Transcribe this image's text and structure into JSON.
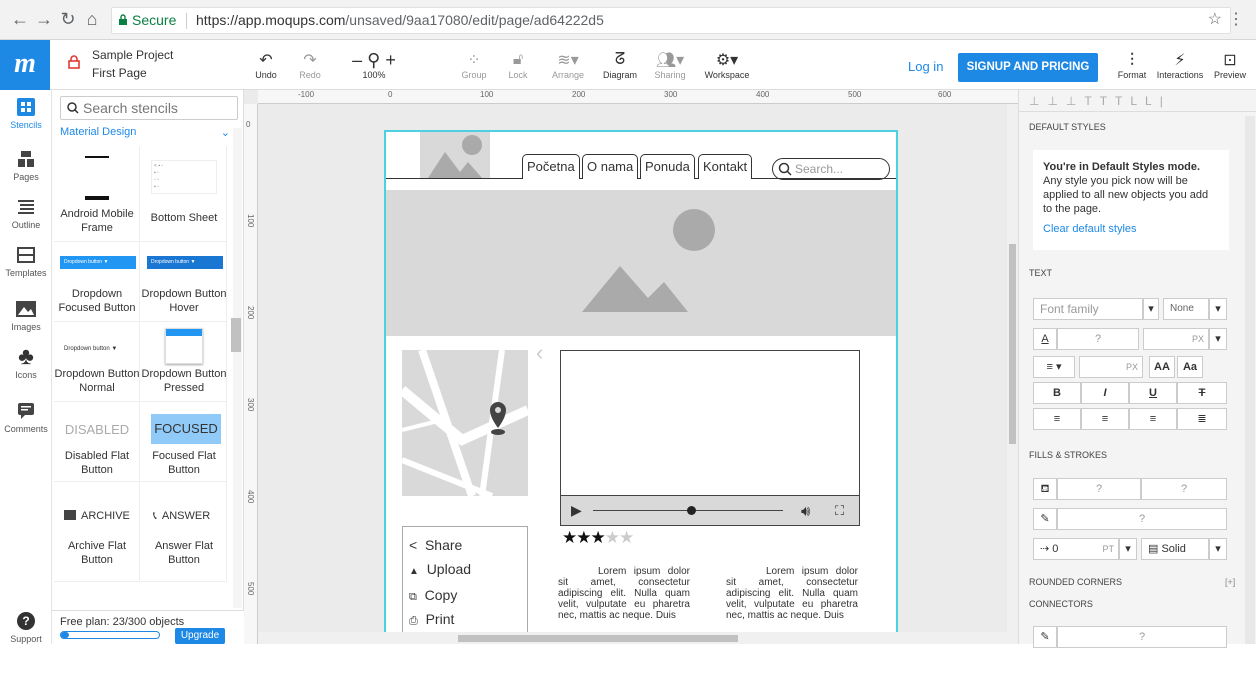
{
  "browser": {
    "secure_label": "Secure",
    "url_host": "https://app.moqups.com",
    "url_path": "/unsaved/9aa17080/edit/page/ad64222d5"
  },
  "app": {
    "logo": "m",
    "project_name": "Sample Project",
    "page_name": "First Page",
    "toolbar": {
      "undo": "Undo",
      "redo": "Redo",
      "zoom": "100%",
      "group": "Group",
      "lock": "Lock",
      "arrange": "Arrange",
      "diagram": "Diagram",
      "sharing": "Sharing",
      "workspace": "Workspace",
      "format": "Format",
      "interactions": "Interactions",
      "preview": "Preview"
    },
    "login": "Log in",
    "signup": "SIGNUP AND PRICING"
  },
  "rail": {
    "stencils": "Stencils",
    "pages": "Pages",
    "outline": "Outline",
    "templates": "Templates",
    "images": "Images",
    "icons": "Icons",
    "comments": "Comments",
    "support": "Support"
  },
  "stencils": {
    "search_placeholder": "Search stencils",
    "library": "Material Design",
    "items": [
      {
        "label": "Android Mobile Frame"
      },
      {
        "label": "Bottom Sheet"
      },
      {
        "label": "Dropdown Focused Button",
        "preview": "Dropdown button"
      },
      {
        "label": "Dropdown Button Hover",
        "preview": "Dropdown button"
      },
      {
        "label": "Dropdown Button Normal",
        "preview": "Dropdown button"
      },
      {
        "label": "Dropdown Button Pressed"
      },
      {
        "label": "Disabled Flat Button",
        "preview": "DISABLED"
      },
      {
        "label": "Focused Flat Button",
        "preview": "FOCUSED"
      },
      {
        "label": "Archive Flat Button",
        "preview": "ARCHIVE"
      },
      {
        "label": "Answer Flat Button",
        "preview": "ANSWER"
      }
    ],
    "plan_text": "Free plan: 23/300 objects",
    "plan_used": 0.077,
    "upgrade": "Upgrade"
  },
  "ruler": {
    "h": [
      "-100",
      "0",
      "100",
      "200",
      "300",
      "400",
      "500",
      "600"
    ],
    "v": [
      "0",
      "100",
      "200",
      "300",
      "400",
      "500"
    ]
  },
  "mockup": {
    "nav": [
      "Početna",
      "O nama",
      "Ponuda",
      "Kontakt"
    ],
    "search_placeholder": "Search...",
    "share_items": [
      "Share",
      "Upload",
      "Copy",
      "Print"
    ],
    "rating": 3,
    "rating_max": 5,
    "lorem": "Lorem ipsum dolor sit amet, consectetur adipiscing elit. Nulla quam velit, vulputate eu pharetra nec, mattis ac neque. Duis"
  },
  "format": {
    "default_styles_header": "DEFAULT STYLES",
    "default_mode_title": "You're in Default Styles mode.",
    "default_mode_text": "Any style you pick now will be applied to all new objects you add to the page.",
    "clear_link": "Clear default styles",
    "text_header": "TEXT",
    "font_family": "Font family",
    "none": "None",
    "q": "?",
    "px": "PX",
    "pt": "PT",
    "bold": "B",
    "italic": "I",
    "underline": "U",
    "strike": "T",
    "aa1": "AA",
    "aa2": "Aa",
    "fills_header": "FILLS & STROKES",
    "stroke_width": "0",
    "stroke_style": "Solid",
    "rounded_header": "ROUNDED CORNERS",
    "rounded_add": "[+]",
    "connectors_header": "CONNECTORS"
  },
  "colors": {
    "accent": "#1e88e5",
    "selection": "#4dd0e1"
  }
}
